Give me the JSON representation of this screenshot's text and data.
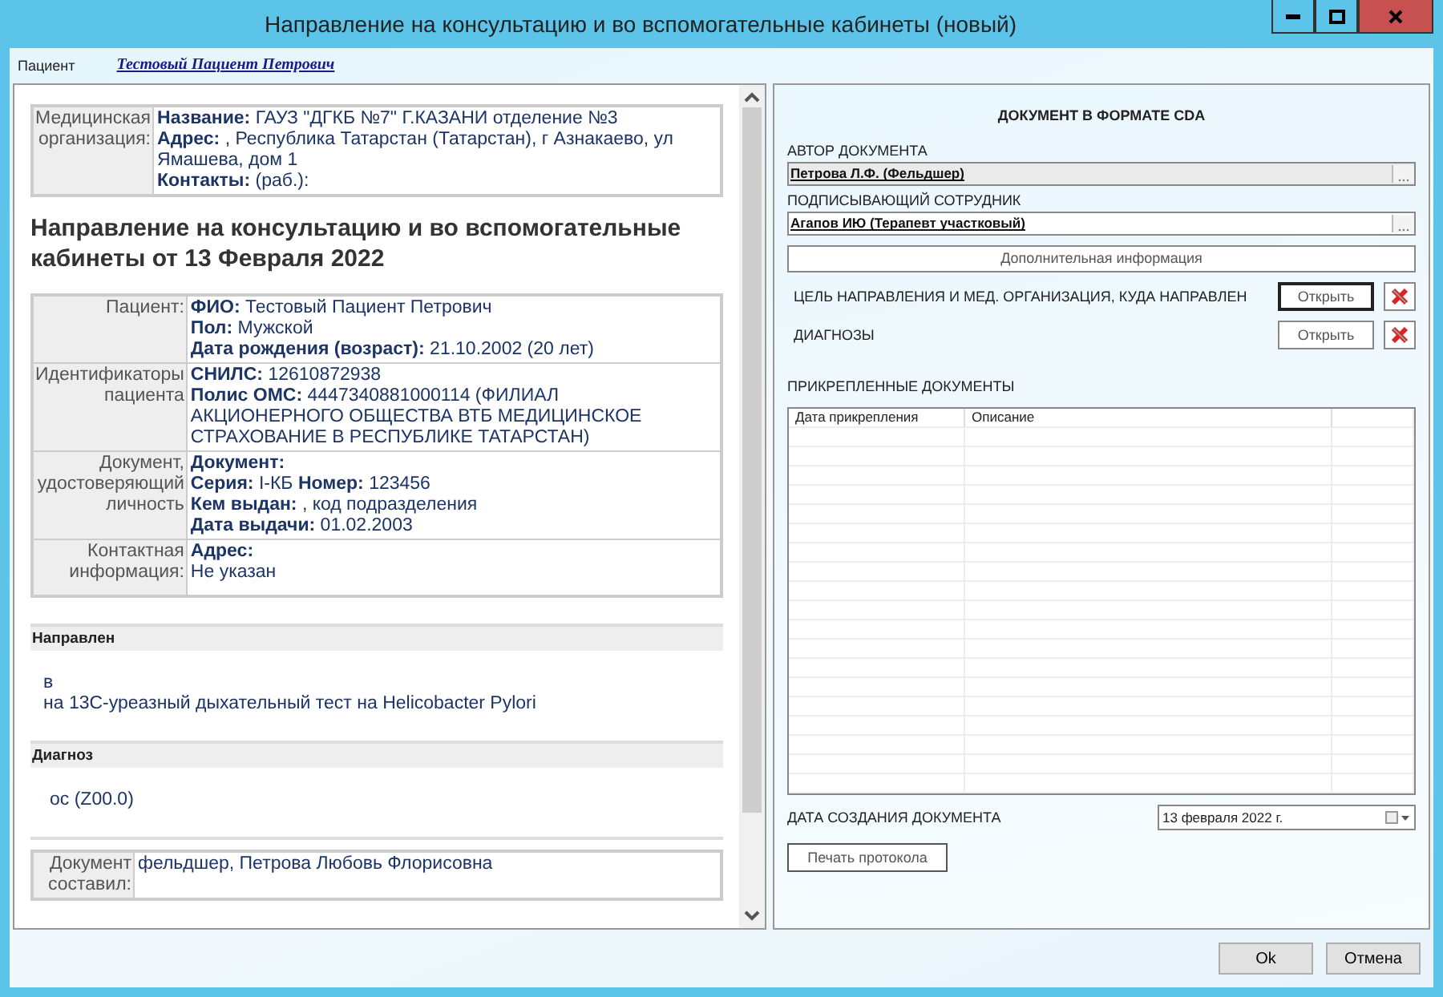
{
  "window": {
    "title": "Направление на консультацию и во вспомогательные кабинеты (новый)"
  },
  "patient": {
    "label": "Пациент",
    "name": "Тестовый Пациент Петрович"
  },
  "document": {
    "org_table": [
      {
        "label": "Медицинская организация:",
        "lines": [
          "**Название:** ГАУЗ \"ДГКБ №7\" Г.КАЗАНИ отделение №3",
          "**Адрес:** , Республика Татарстан (Татарстан), г Азнакаево, ул Ямашева, дом 1",
          "**Контакты:** (раб.):"
        ]
      }
    ],
    "heading": "Направление на консультацию и во вспомогательные кабинеты от 13 Февраля 2022",
    "patient_table": [
      {
        "label": "Пациент:",
        "lines": [
          "**ФИО:** Тестовый Пациент Петрович",
          "**Пол:** Мужской",
          "**Дата рождения (возраст):** 21.10.2002 (20 лет)"
        ]
      },
      {
        "label": "Идентификаторы пациента",
        "lines": [
          "**СНИЛС:** 12610872938",
          "**Полис ОМС:** 4447340881000114 (ФИЛИАЛ АКЦИОНЕРНОГО ОБЩЕСТВА ВТБ МЕДИЦИНСКОЕ СТРАХОВАНИЕ В РЕСПУБЛИКЕ ТАТАРСТАН)"
        ]
      },
      {
        "label": "Документ, удостоверяющий личность",
        "lines": [
          "**Документ:**",
          "**Серия:** I-КБ **Номер:** 123456",
          "**Кем выдан:** , код подразделения",
          "**Дата выдачи:** 01.02.2003"
        ]
      },
      {
        "label": "Контактная информация:",
        "lines": [
          "**Адрес:**",
          "Не указан"
        ]
      }
    ],
    "sections": [
      {
        "title": "Направлен",
        "lines": [
          "в",
          "на 13С-уреазный дыхательный тест на Helicobacter Pylori"
        ]
      },
      {
        "title": "Диагноз",
        "lines": [
          "ос (Z00.0)"
        ]
      }
    ],
    "author_table": [
      {
        "label": "Документ составил:",
        "lines": [
          "фельдшер, Петрова Любовь Флорисовна"
        ]
      }
    ]
  },
  "cda": {
    "title": "ДОКУМЕНТ В ФОРМАТЕ CDA",
    "author": {
      "label": "АВТОР ДОКУМЕНТА",
      "value": "Петрова Л.Ф. (Фельдшер)",
      "disabled": true
    },
    "signer": {
      "label": "ПОДПИСЫВАЮЩИЙ СОТРУДНИК",
      "value": "Агапов ИЮ (Терапевт участковый)",
      "disabled": false
    },
    "extra_button": "Дополнительная информация",
    "items": [
      {
        "label": "ЦЕЛЬ НАПРАВЛЕНИЯ И МЕД. ОРГАНИЗАЦИЯ, КУДА НАПРАВЛЕН",
        "button": "Открыть",
        "focused": true
      },
      {
        "label": "ДИАГНОЗЫ",
        "button": "Открыть",
        "focused": false
      }
    ],
    "attached": {
      "label": "ПРИКРЕПЛЕННЫЕ ДОКУМЕНТЫ",
      "columns": [
        "Дата прикрепления",
        "Описание"
      ]
    },
    "date": {
      "label": "ДАТА СОЗДАНИЯ ДОКУМЕНТА",
      "value": "13 февраля  2022 г."
    },
    "print_button": "Печать протокола"
  },
  "buttons": [
    "Ok",
    "Отмена"
  ]
}
